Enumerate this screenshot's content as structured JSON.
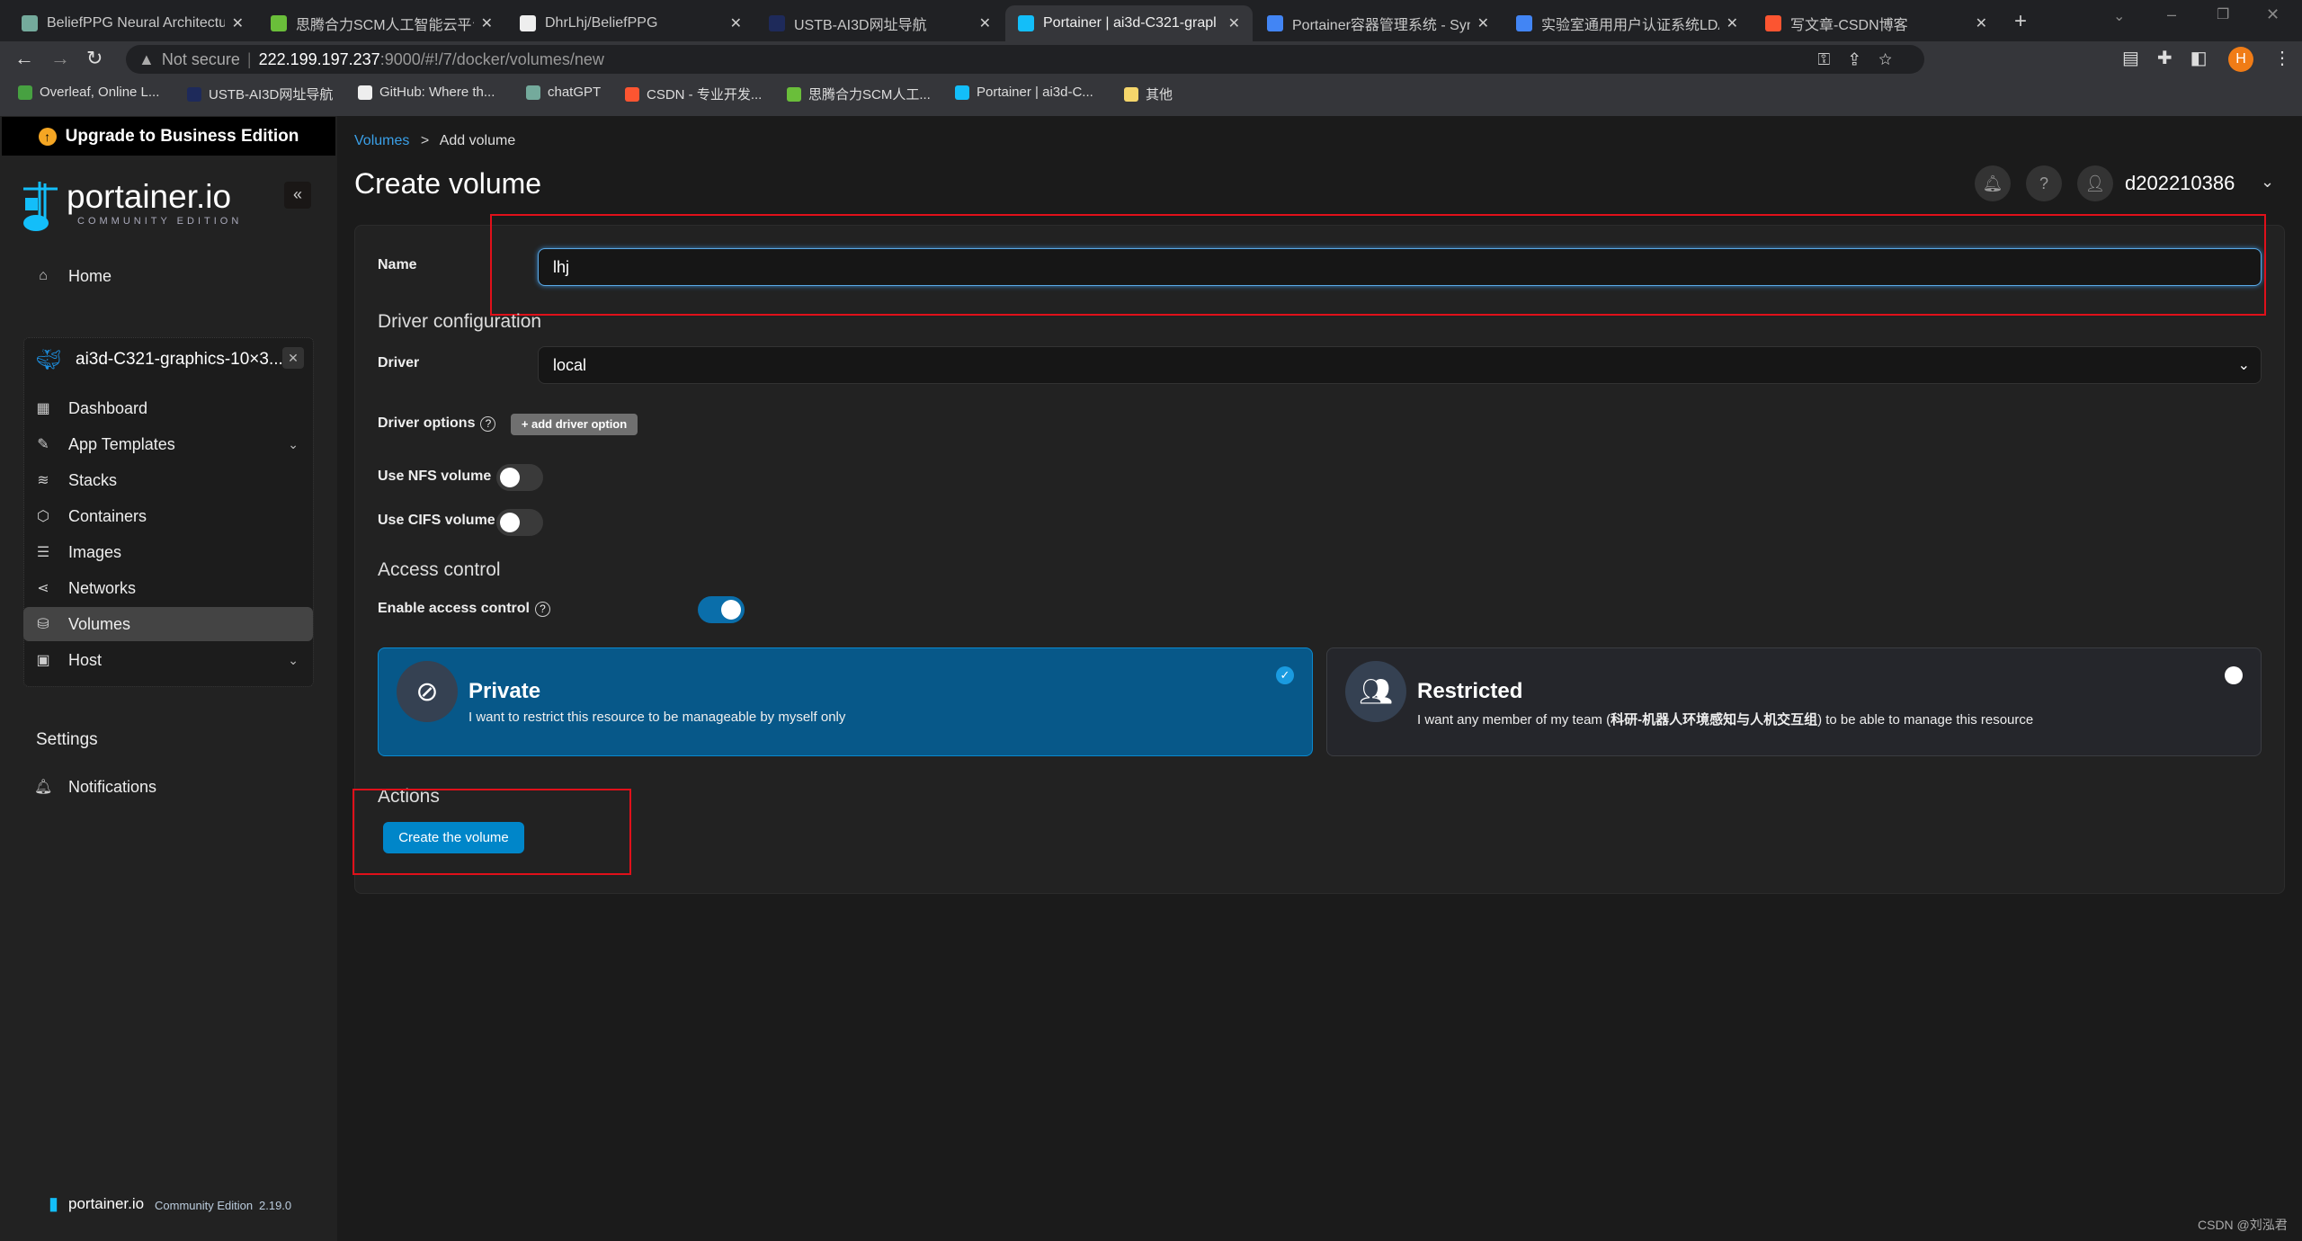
{
  "browser": {
    "tabs": [
      {
        "title": "BeliefPPG Neural Architectu",
        "color": "#74aa9c"
      },
      {
        "title": "思腾合力SCM人工智能云平台",
        "color": "#6abe3a"
      },
      {
        "title": "DhrLhj/BeliefPPG",
        "color": "#eeeeee"
      },
      {
        "title": "USTB-AI3D网址导航",
        "color": "#1e2a5a"
      },
      {
        "title": "Portainer | ai3d-C321-grapl",
        "color": "#13bef9"
      },
      {
        "title": "Portainer容器管理系统 - Syn",
        "color": "#4285f4"
      },
      {
        "title": "实验室通用用户认证系统LDA",
        "color": "#4285f4"
      },
      {
        "title": "写文章-CSDN博客",
        "color": "#fc5531"
      }
    ],
    "active_tab": 4,
    "security": "Not secure",
    "url_host": "222.199.197.237",
    "url_rest": ":9000/#!/7/docker/volumes/new",
    "profile_initial": "H",
    "bookmarks": [
      {
        "title": "Overleaf, Online L...",
        "color": "#47a141"
      },
      {
        "title": "USTB-AI3D网址导航",
        "color": "#1e2a5a"
      },
      {
        "title": "GitHub: Where th...",
        "color": "#eeeeee"
      },
      {
        "title": "chatGPT",
        "color": "#74aa9c"
      },
      {
        "title": "CSDN - 专业开发...",
        "color": "#fc5531"
      },
      {
        "title": "思腾合力SCM人工...",
        "color": "#6abe3a"
      },
      {
        "title": "Portainer | ai3d-C...",
        "color": "#13bef9"
      },
      {
        "title": "其他",
        "color": "#f5d66b"
      }
    ]
  },
  "sidebar": {
    "upgrade": "Upgrade to Business Edition",
    "logo_text": "portainer.io",
    "logo_sub": "COMMUNITY EDITION",
    "home": "Home",
    "environment": "ai3d-C321-graphics-10×3...",
    "items": [
      {
        "label": "Dashboard",
        "icon": "dashboard-icon",
        "glyph": "▦"
      },
      {
        "label": "App Templates",
        "icon": "edit-icon",
        "glyph": "✎",
        "chevron": true
      },
      {
        "label": "Stacks",
        "icon": "layers-icon",
        "glyph": "≋"
      },
      {
        "label": "Containers",
        "icon": "box-icon",
        "glyph": "⬡"
      },
      {
        "label": "Images",
        "icon": "list-icon",
        "glyph": "☰"
      },
      {
        "label": "Networks",
        "icon": "share-icon",
        "glyph": "⋖"
      },
      {
        "label": "Volumes",
        "icon": "database-icon",
        "glyph": "⛁",
        "active": true
      },
      {
        "label": "Host",
        "icon": "server-icon",
        "glyph": "▣",
        "chevron": true
      }
    ],
    "settings": "Settings",
    "notifications": "Notifications",
    "footer_logo": "portainer.io",
    "footer_edition": "Community Edition",
    "footer_version": "2.19.0"
  },
  "header": {
    "breadcrumb_link": "Volumes",
    "breadcrumb_sep": ">",
    "breadcrumb_current": "Add volume",
    "title": "Create volume",
    "username": "d202210386"
  },
  "form": {
    "name_label": "Name",
    "name_value": "lhj",
    "driver_config": "Driver configuration",
    "driver_label": "Driver",
    "driver_value": "local",
    "driver_options_label": "Driver options",
    "add_driver_option": "+ add driver option",
    "nfs_label": "Use NFS volume",
    "nfs_on": false,
    "cifs_label": "Use CIFS volume",
    "cifs_on": false,
    "access_control": "Access control",
    "enable_access_label": "Enable access control",
    "enable_access_on": true,
    "private_title": "Private",
    "private_desc": "I want to restrict this resource to be manageable by myself only",
    "restricted_title": "Restricted",
    "restricted_desc_pre": "I want any member of my team (",
    "restricted_team": "科研-机器人环境感知与人机交互组",
    "restricted_desc_post": ") to be able to manage this resource",
    "selected": "Private",
    "actions": "Actions",
    "create_button": "Create the volume"
  },
  "colors": {
    "accent": "#0086c9",
    "selected_card": "#075889",
    "highlight_box": "#e0101a"
  },
  "watermark": "CSDN @刘泓君"
}
